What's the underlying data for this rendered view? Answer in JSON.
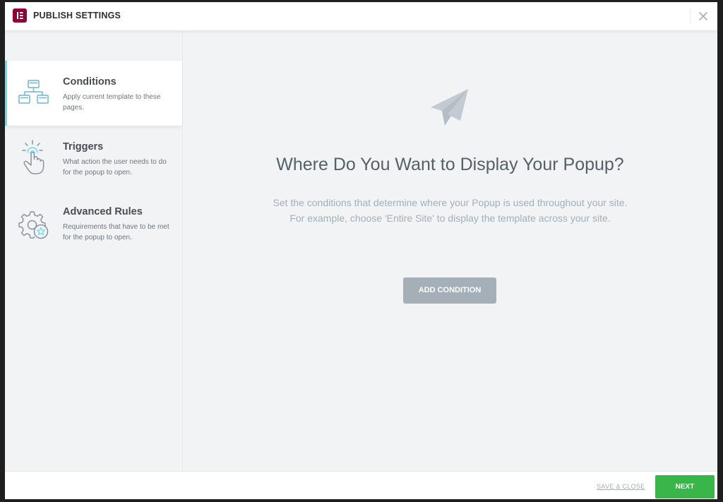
{
  "header": {
    "title": "PUBLISH SETTINGS",
    "logo_icon": "elementor-logo-icon",
    "close_icon": "close-icon"
  },
  "sidebar": {
    "items": [
      {
        "title": "Conditions",
        "description": "Apply current template to these pages.",
        "icon": "sitemap-icon",
        "active": true
      },
      {
        "title": "Triggers",
        "description": "What action the user needs to do for the popup to open.",
        "icon": "pointer-click-icon",
        "active": false
      },
      {
        "title": "Advanced Rules",
        "description": "Requirements that have to be met for the popup to open.",
        "icon": "gear-star-icon",
        "active": false
      }
    ]
  },
  "main": {
    "icon": "paper-plane-icon",
    "title": "Where Do You Want to Display Your Popup?",
    "description_line1": "Set the conditions that determine where your Popup is used throughout your site.",
    "description_line2": "For example, choose 'Entire Site' to display the template across your site.",
    "add_button": "ADD CONDITION"
  },
  "footer": {
    "save_close": "SAVE & CLOSE",
    "next": "NEXT"
  },
  "colors": {
    "brand": "#92003b",
    "accent": "#71d7f7",
    "success": "#39b54a",
    "muted_button": "#a4afb7"
  }
}
